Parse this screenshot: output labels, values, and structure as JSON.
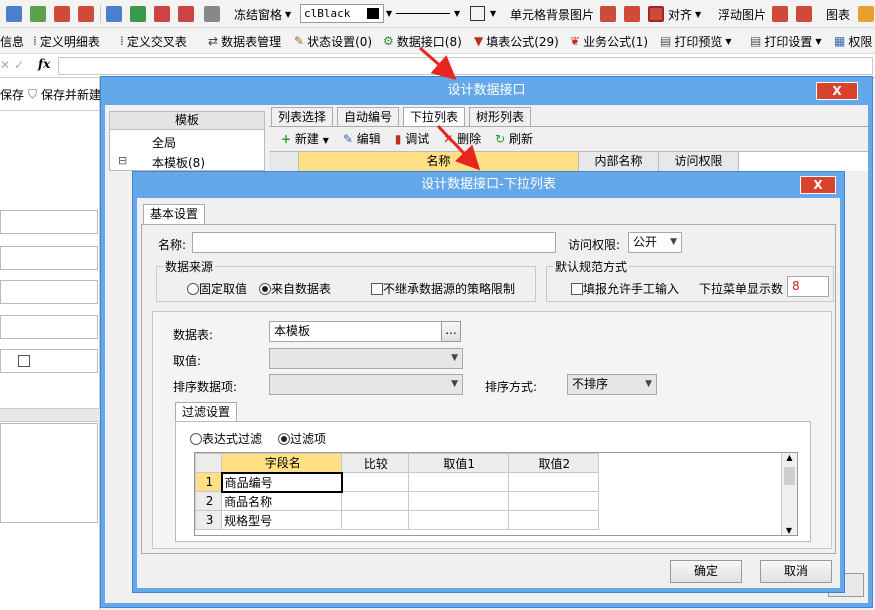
{
  "toolbar1": {
    "freeze_label": "冻结窗格",
    "font_color_value": "clBlack",
    "cell_bg_label": "单元格背景图片",
    "align_label": "对齐",
    "float_image_label": "浮动图片",
    "chart_label": "图表"
  },
  "toolbar2": {
    "items": [
      "信息",
      "定义明细表",
      "定义交叉表",
      "数据表管理",
      "状态设置(0)",
      "数据接口(8)",
      "填表公式(29)",
      "业务公式(1)",
      "打印预览",
      "打印设置",
      "权限"
    ]
  },
  "formula_bar": {
    "fx": "fx"
  },
  "left_panel": {
    "save_label": "保存",
    "save_new_label": "保存并新建"
  },
  "outer_dialog": {
    "title": "设计数据接口",
    "close": "X",
    "tree_header": "模板",
    "tree_items": [
      "全局",
      "本模板(8)"
    ],
    "tree_toggle": "⊟",
    "tabs": [
      "列表选择",
      "自动编号",
      "下拉列表",
      "树形列表"
    ],
    "actions": [
      "新建",
      "编辑",
      "调试",
      "删除",
      "刷新"
    ],
    "columns": [
      "名称",
      "内部名称",
      "访问权限"
    ]
  },
  "inner_dialog": {
    "title": "设计数据接口-下拉列表",
    "close": "X",
    "tab": "基本设置",
    "name_label": "名称:",
    "name_value": "",
    "access_label": "访问权限:",
    "access_value": "公开",
    "source_group": "数据来源",
    "source_fixed": "固定取值",
    "source_data": "来自数据表",
    "no_inherit": "不继承数据源的策略限制",
    "norm_group": "默认规范方式",
    "allow_manual": "填报允许手工输入",
    "dropdown_count_label": "下拉菜单显示数",
    "dropdown_count_value": "8",
    "table_label": "数据表:",
    "table_value": "本模板",
    "browse": "...",
    "value_label": "取值:",
    "sort_item_label": "排序数据项:",
    "sort_mode_label": "排序方式:",
    "sort_mode_value": "不排序",
    "filter_tab": "过滤设置",
    "filter_expr": "表达式过滤",
    "filter_item": "过滤项",
    "grid_columns": [
      "字段名",
      "比较",
      "取值1",
      "取值2"
    ],
    "grid_rows": [
      {
        "n": "1",
        "field": "商品编号"
      },
      {
        "n": "2",
        "field": "商品名称"
      },
      {
        "n": "3",
        "field": "规格型号"
      }
    ],
    "ok": "确定",
    "cancel": "取消"
  },
  "colors": {
    "dialog_frame": "#64a8ea",
    "close_red": "#d9432e",
    "header_yellow": "#ffe084",
    "arrow_red": "#e8261f"
  }
}
